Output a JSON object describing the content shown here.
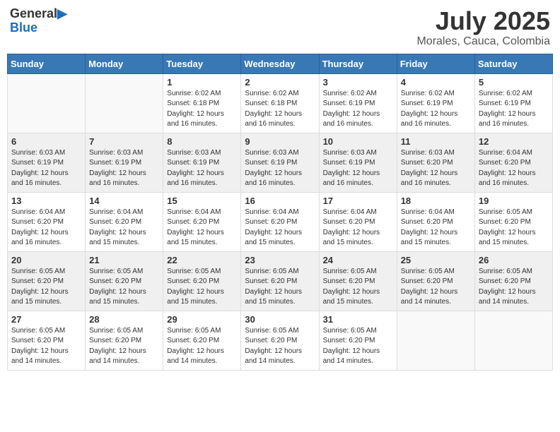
{
  "header": {
    "logo_line1": "General",
    "logo_line2": "Blue",
    "month_year": "July 2025",
    "location": "Morales, Cauca, Colombia"
  },
  "days_of_week": [
    "Sunday",
    "Monday",
    "Tuesday",
    "Wednesday",
    "Thursday",
    "Friday",
    "Saturday"
  ],
  "weeks": [
    [
      {
        "day": "",
        "info": ""
      },
      {
        "day": "",
        "info": ""
      },
      {
        "day": "1",
        "info": "Sunrise: 6:02 AM\nSunset: 6:18 PM\nDaylight: 12 hours and 16 minutes."
      },
      {
        "day": "2",
        "info": "Sunrise: 6:02 AM\nSunset: 6:18 PM\nDaylight: 12 hours and 16 minutes."
      },
      {
        "day": "3",
        "info": "Sunrise: 6:02 AM\nSunset: 6:19 PM\nDaylight: 12 hours and 16 minutes."
      },
      {
        "day": "4",
        "info": "Sunrise: 6:02 AM\nSunset: 6:19 PM\nDaylight: 12 hours and 16 minutes."
      },
      {
        "day": "5",
        "info": "Sunrise: 6:02 AM\nSunset: 6:19 PM\nDaylight: 12 hours and 16 minutes."
      }
    ],
    [
      {
        "day": "6",
        "info": "Sunrise: 6:03 AM\nSunset: 6:19 PM\nDaylight: 12 hours and 16 minutes."
      },
      {
        "day": "7",
        "info": "Sunrise: 6:03 AM\nSunset: 6:19 PM\nDaylight: 12 hours and 16 minutes."
      },
      {
        "day": "8",
        "info": "Sunrise: 6:03 AM\nSunset: 6:19 PM\nDaylight: 12 hours and 16 minutes."
      },
      {
        "day": "9",
        "info": "Sunrise: 6:03 AM\nSunset: 6:19 PM\nDaylight: 12 hours and 16 minutes."
      },
      {
        "day": "10",
        "info": "Sunrise: 6:03 AM\nSunset: 6:19 PM\nDaylight: 12 hours and 16 minutes."
      },
      {
        "day": "11",
        "info": "Sunrise: 6:03 AM\nSunset: 6:20 PM\nDaylight: 12 hours and 16 minutes."
      },
      {
        "day": "12",
        "info": "Sunrise: 6:04 AM\nSunset: 6:20 PM\nDaylight: 12 hours and 16 minutes."
      }
    ],
    [
      {
        "day": "13",
        "info": "Sunrise: 6:04 AM\nSunset: 6:20 PM\nDaylight: 12 hours and 16 minutes."
      },
      {
        "day": "14",
        "info": "Sunrise: 6:04 AM\nSunset: 6:20 PM\nDaylight: 12 hours and 15 minutes."
      },
      {
        "day": "15",
        "info": "Sunrise: 6:04 AM\nSunset: 6:20 PM\nDaylight: 12 hours and 15 minutes."
      },
      {
        "day": "16",
        "info": "Sunrise: 6:04 AM\nSunset: 6:20 PM\nDaylight: 12 hours and 15 minutes."
      },
      {
        "day": "17",
        "info": "Sunrise: 6:04 AM\nSunset: 6:20 PM\nDaylight: 12 hours and 15 minutes."
      },
      {
        "day": "18",
        "info": "Sunrise: 6:04 AM\nSunset: 6:20 PM\nDaylight: 12 hours and 15 minutes."
      },
      {
        "day": "19",
        "info": "Sunrise: 6:05 AM\nSunset: 6:20 PM\nDaylight: 12 hours and 15 minutes."
      }
    ],
    [
      {
        "day": "20",
        "info": "Sunrise: 6:05 AM\nSunset: 6:20 PM\nDaylight: 12 hours and 15 minutes."
      },
      {
        "day": "21",
        "info": "Sunrise: 6:05 AM\nSunset: 6:20 PM\nDaylight: 12 hours and 15 minutes."
      },
      {
        "day": "22",
        "info": "Sunrise: 6:05 AM\nSunset: 6:20 PM\nDaylight: 12 hours and 15 minutes."
      },
      {
        "day": "23",
        "info": "Sunrise: 6:05 AM\nSunset: 6:20 PM\nDaylight: 12 hours and 15 minutes."
      },
      {
        "day": "24",
        "info": "Sunrise: 6:05 AM\nSunset: 6:20 PM\nDaylight: 12 hours and 15 minutes."
      },
      {
        "day": "25",
        "info": "Sunrise: 6:05 AM\nSunset: 6:20 PM\nDaylight: 12 hours and 14 minutes."
      },
      {
        "day": "26",
        "info": "Sunrise: 6:05 AM\nSunset: 6:20 PM\nDaylight: 12 hours and 14 minutes."
      }
    ],
    [
      {
        "day": "27",
        "info": "Sunrise: 6:05 AM\nSunset: 6:20 PM\nDaylight: 12 hours and 14 minutes."
      },
      {
        "day": "28",
        "info": "Sunrise: 6:05 AM\nSunset: 6:20 PM\nDaylight: 12 hours and 14 minutes."
      },
      {
        "day": "29",
        "info": "Sunrise: 6:05 AM\nSunset: 6:20 PM\nDaylight: 12 hours and 14 minutes."
      },
      {
        "day": "30",
        "info": "Sunrise: 6:05 AM\nSunset: 6:20 PM\nDaylight: 12 hours and 14 minutes."
      },
      {
        "day": "31",
        "info": "Sunrise: 6:05 AM\nSunset: 6:20 PM\nDaylight: 12 hours and 14 minutes."
      },
      {
        "day": "",
        "info": ""
      },
      {
        "day": "",
        "info": ""
      }
    ]
  ]
}
